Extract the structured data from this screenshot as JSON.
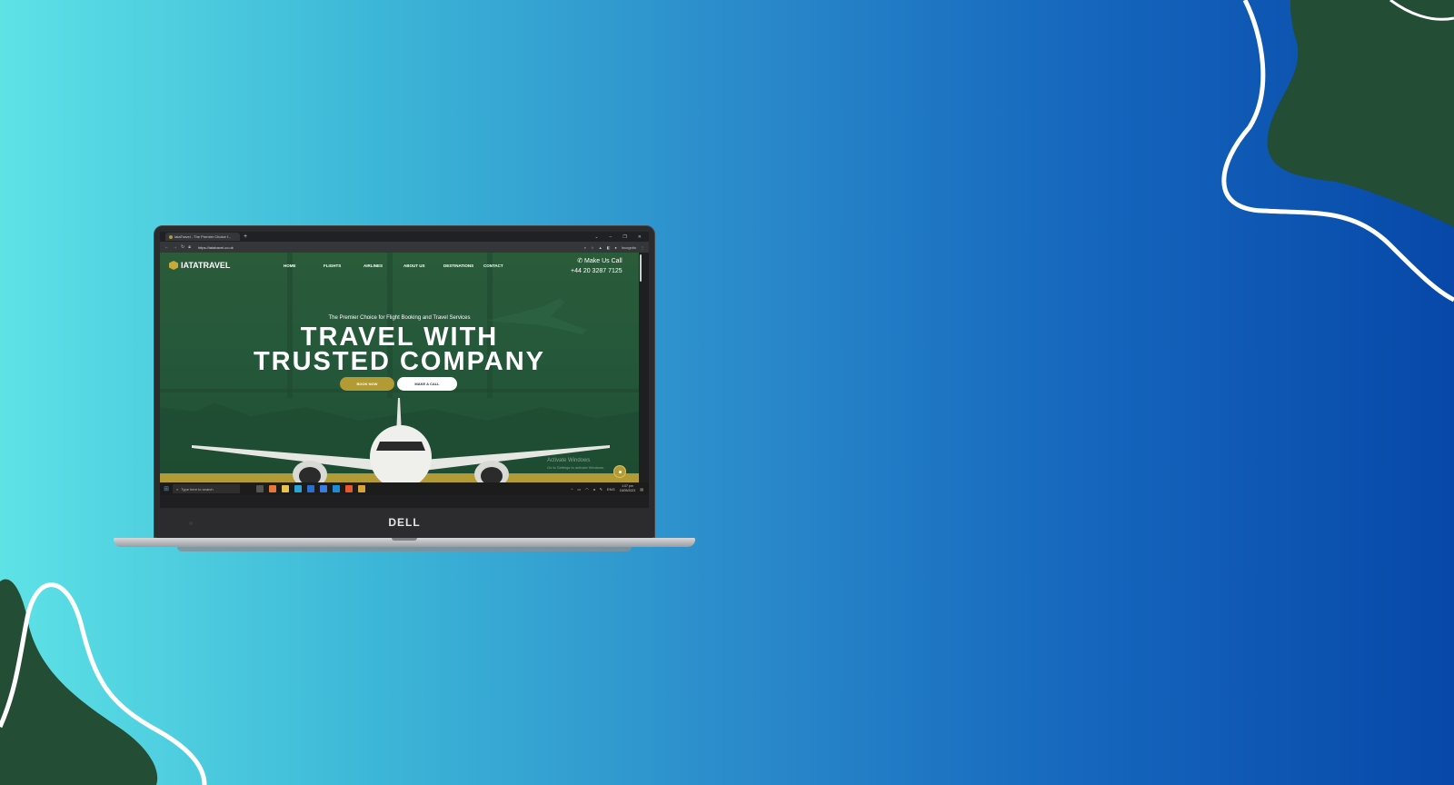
{
  "device": {
    "brand_logo": "DELL"
  },
  "browser": {
    "tab_title": "IataTravel - The Premier Choice f...",
    "new_tab_icon": "plus-icon",
    "url": "https://iatatravel.co.uk",
    "profile_label": "Incognito"
  },
  "website": {
    "logo_text": "IATATRAVEL",
    "nav": [
      "HOME",
      "FLIGHTS",
      "AIRLINES",
      "ABOUT US",
      "DESTINATIONS",
      "CONTACT"
    ],
    "call_label": "Make Us Call",
    "phone": "+44 20 3287 7125",
    "tagline": "The Premier Choice for Flight Booking and Travel Services",
    "headline_line1": "TRAVEL WITH",
    "headline_line2": "TRUSTED COMPANY",
    "book_button": "BOOK NOW",
    "call_button": "MAKE A CALL",
    "watermark_title": "Activate Windows",
    "watermark_sub": "Go to Settings to activate Windows."
  },
  "taskbar": {
    "search_placeholder": "Type here to search",
    "language": "ENG",
    "time": "1:07 pm",
    "date": "15/05/2023"
  },
  "colors": {
    "bg_left": "#5ee2e6",
    "bg_right": "#0748a8",
    "decor_green": "#234d34",
    "site_green": "#24563a",
    "gold": "#b29a34"
  }
}
